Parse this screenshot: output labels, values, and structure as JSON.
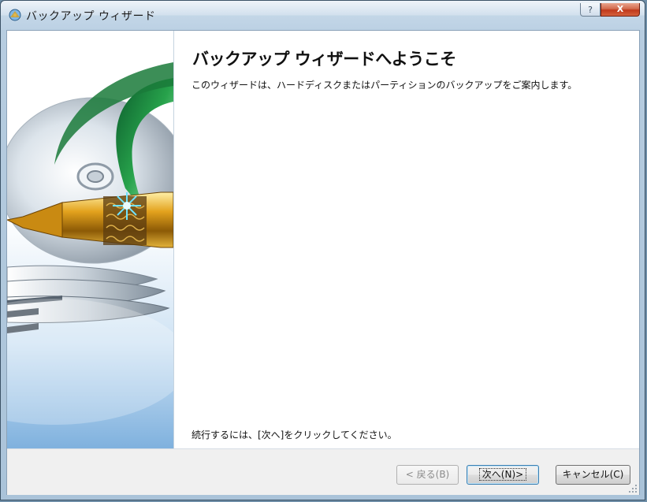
{
  "window": {
    "title": "バックアップ ウィザード",
    "help_label": "?",
    "close_label": "X"
  },
  "content": {
    "heading": "バックアップ ウィザードへようこそ",
    "description": "このウィザードは、ハードディスクまたはパーティションのバックアップをご案内します。",
    "continue_text": "続行するには、[次へ]をクリックしてください。"
  },
  "buttons": {
    "back": "< 戻る(B)",
    "next": "次へ(N)>",
    "cancel": "キャンセル(C)"
  },
  "icons": {
    "app": "backup-app-icon",
    "side": "disk-pen-illustration"
  }
}
